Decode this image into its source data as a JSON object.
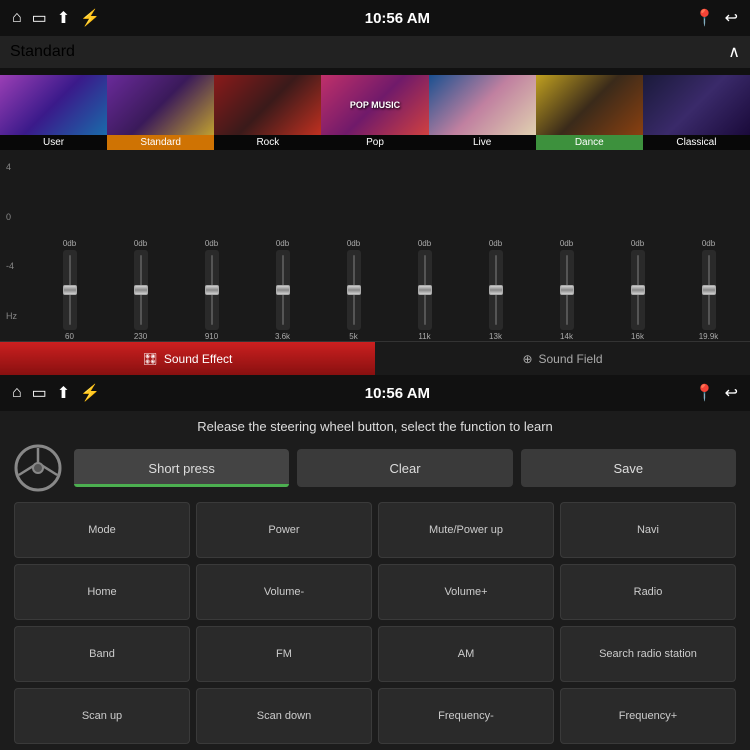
{
  "top": {
    "statusBar": {
      "time": "10:56 AM"
    },
    "presets": {
      "label": "Standard",
      "items": [
        {
          "id": "user",
          "label": "User",
          "active": false
        },
        {
          "id": "standard",
          "label": "Standard",
          "active": true
        },
        {
          "id": "rock",
          "label": "Rock",
          "active": false
        },
        {
          "id": "pop",
          "label": "Pop",
          "active": false
        },
        {
          "id": "live",
          "label": "Live",
          "active": false
        },
        {
          "id": "dance",
          "label": "Dance",
          "active": false
        },
        {
          "id": "classical",
          "label": "Classical",
          "active": false
        }
      ]
    },
    "eq": {
      "bands": [
        {
          "db": "0db",
          "freq": "60"
        },
        {
          "db": "0db",
          "freq": "230"
        },
        {
          "db": "0db",
          "freq": "910"
        },
        {
          "db": "0db",
          "freq": "3.6k"
        },
        {
          "db": "0db",
          "freq": "5k"
        },
        {
          "db": "0db",
          "freq": "11k"
        },
        {
          "db": "0db",
          "freq": "13k"
        },
        {
          "db": "0db",
          "freq": "14k"
        },
        {
          "db": "0db",
          "freq": "16k"
        },
        {
          "db": "0db",
          "freq": "19.9k"
        }
      ],
      "axisLabels": [
        "4",
        "0",
        "-4",
        "Hz"
      ]
    },
    "tabs": {
      "soundEffect": "Sound Effect",
      "soundField": "Sound Field"
    }
  },
  "bottom": {
    "statusBar": {
      "time": "10:56 AM"
    },
    "instruction": "Release the steering wheel button, select the function to learn",
    "actions": {
      "shortPress": "Short press",
      "clear": "Clear",
      "save": "Save"
    },
    "functions": [
      "Mode",
      "Power",
      "Mute/Power up",
      "Navi",
      "Home",
      "Volume-",
      "Volume+",
      "Radio",
      "Band",
      "FM",
      "AM",
      "Search radio station",
      "Scan up",
      "Scan down",
      "Frequency-",
      "Frequency+"
    ]
  }
}
